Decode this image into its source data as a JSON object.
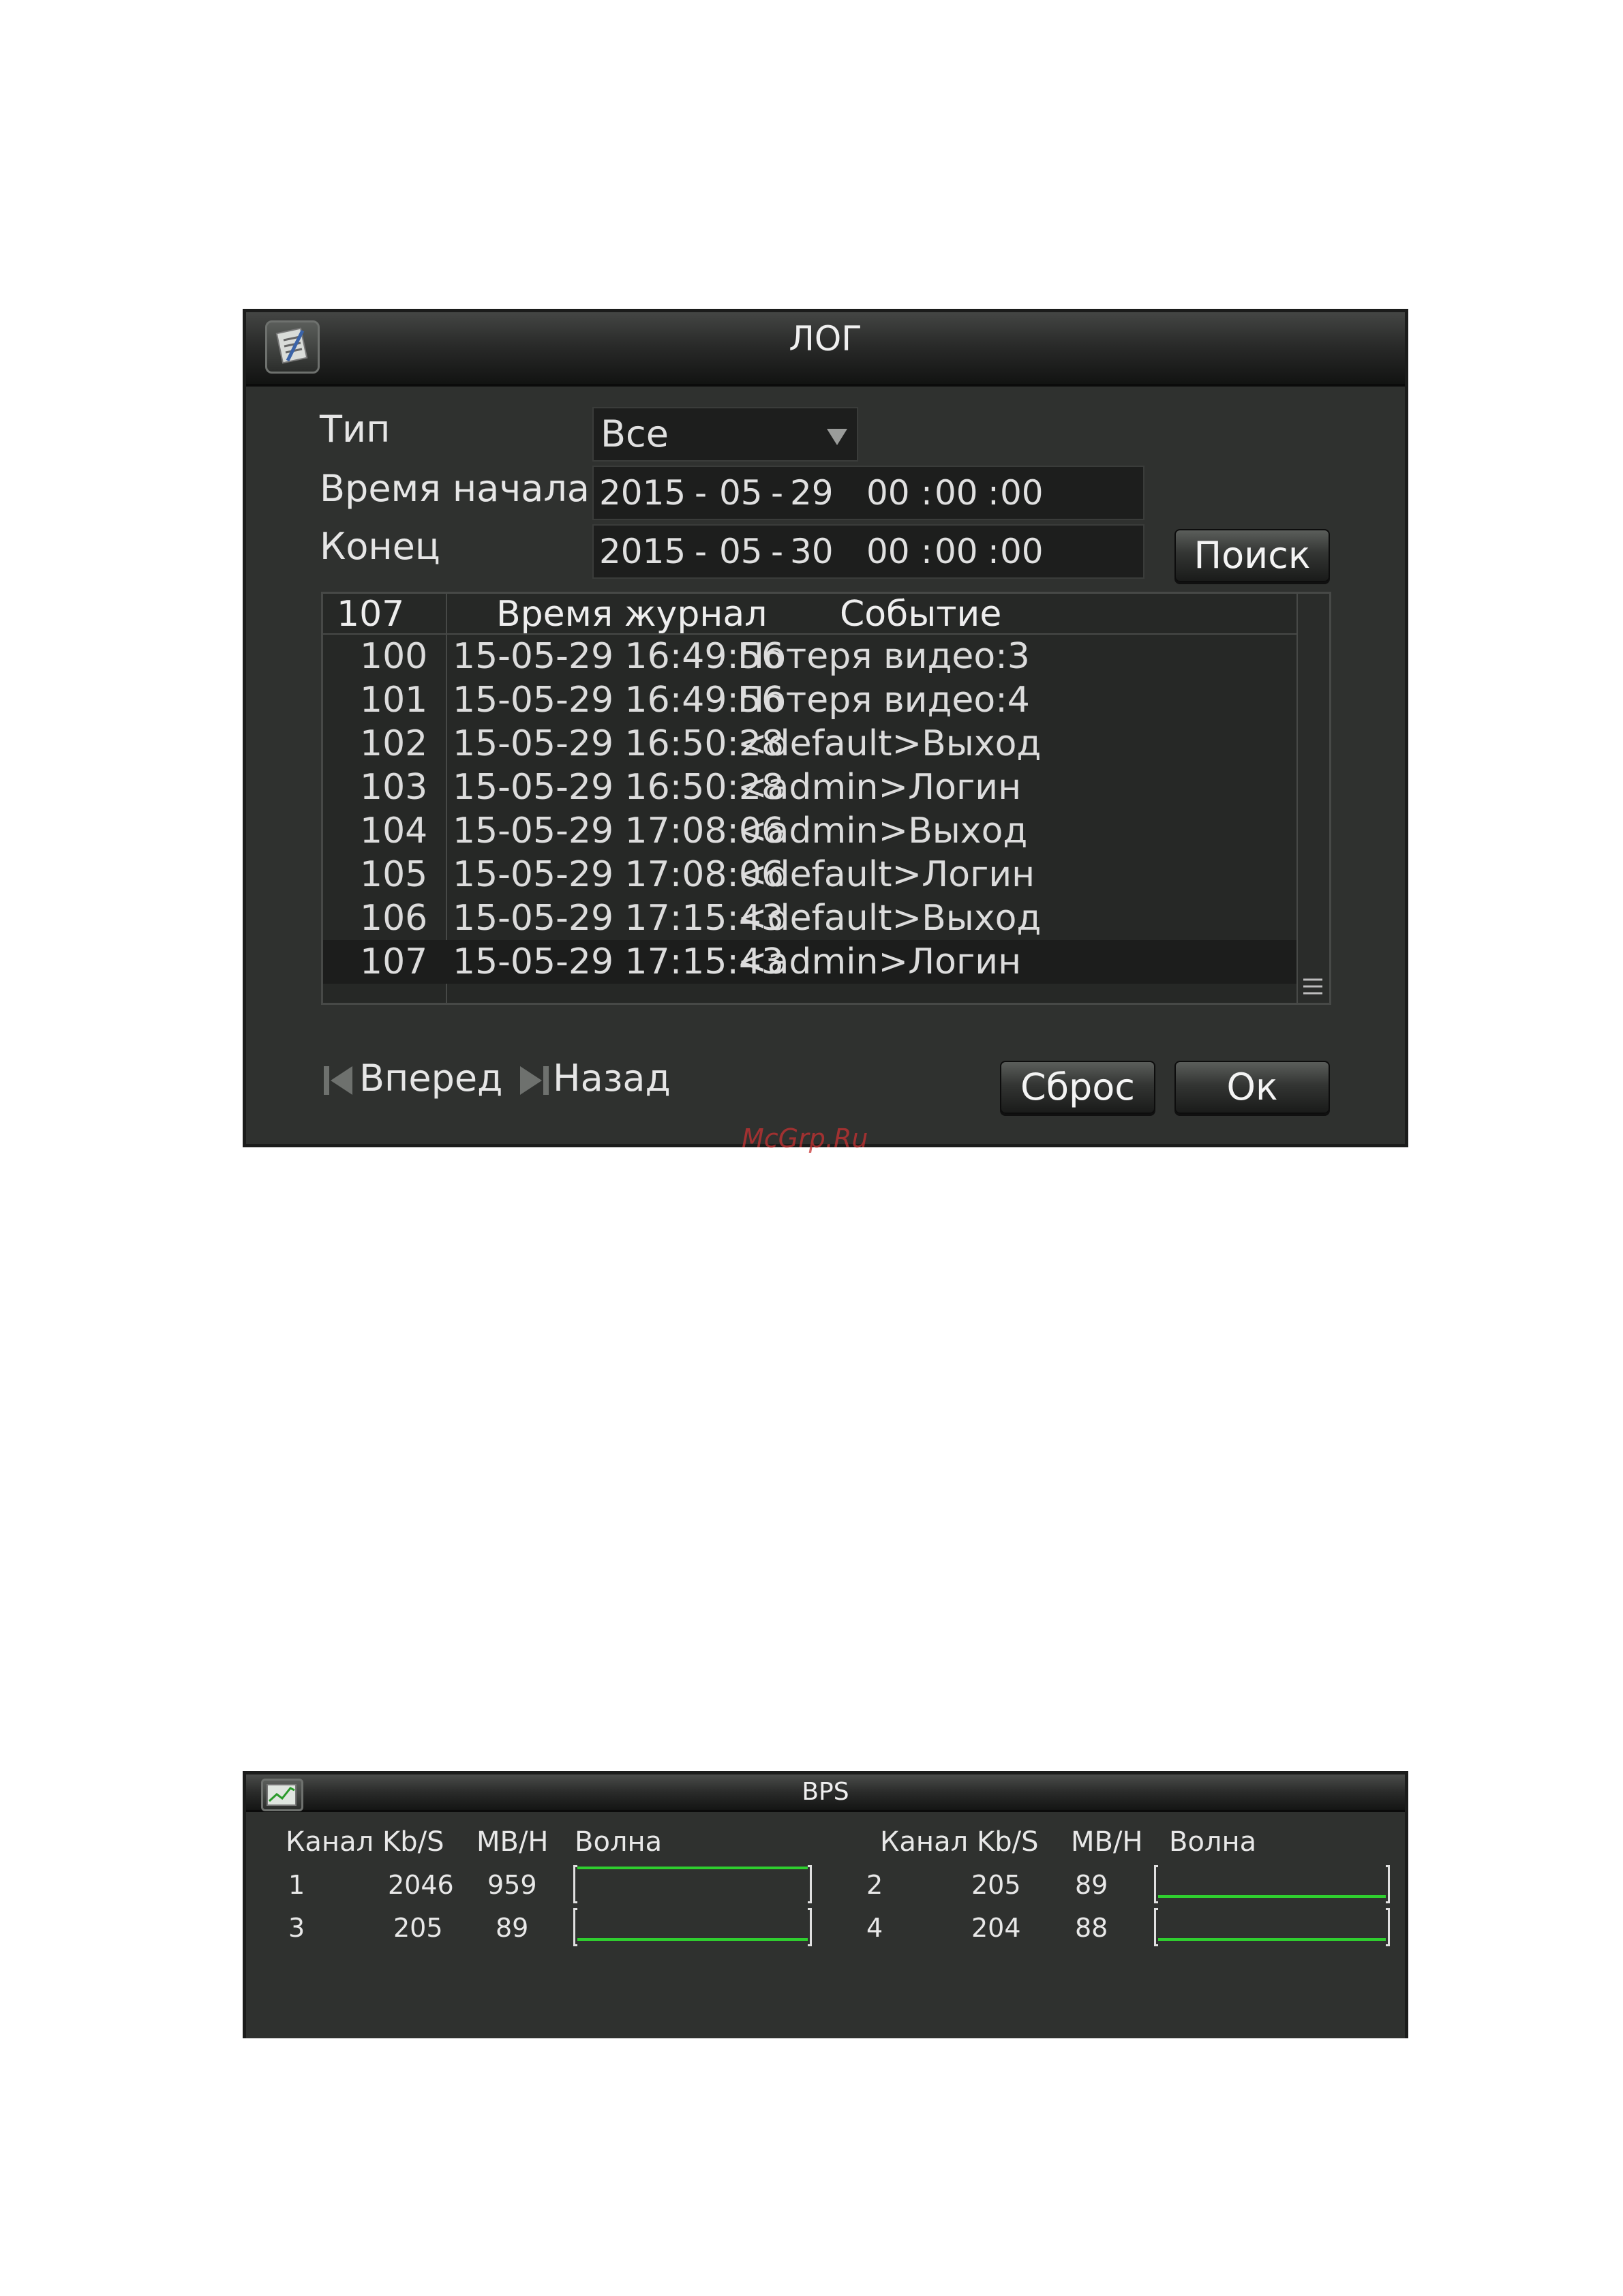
{
  "log": {
    "title": "ЛОГ",
    "type_label": "Тип",
    "type_value": "Все",
    "start_label": "Время начала",
    "start": {
      "year": "2015",
      "month": "05",
      "day": "29",
      "hh": "00",
      "mm": "00",
      "ss": "00"
    },
    "end_label": "Конец",
    "end": {
      "year": "2015",
      "month": "05",
      "day": "30",
      "hh": "00",
      "mm": "00",
      "ss": "00"
    },
    "search_button": "Поиск",
    "table": {
      "total": "107",
      "col_time": "Время журнал",
      "col_event": "Событие",
      "rows": [
        {
          "num": "100",
          "time": "15-05-29 16:49:56",
          "event": "Потеря видео:3"
        },
        {
          "num": "101",
          "time": "15-05-29 16:49:56",
          "event": "Потеря видео:4"
        },
        {
          "num": "102",
          "time": "15-05-29 16:50:28",
          "event": "<default>Выход"
        },
        {
          "num": "103",
          "time": "15-05-29 16:50:28",
          "event": "<admin>Логин"
        },
        {
          "num": "104",
          "time": "15-05-29 17:08:06",
          "event": "<admin>Выход"
        },
        {
          "num": "105",
          "time": "15-05-29 17:08:06",
          "event": "<default>Логин"
        },
        {
          "num": "106",
          "time": "15-05-29 17:15:43",
          "event": "<default>Выход"
        },
        {
          "num": "107",
          "time": "15-05-29 17:15:43",
          "event": "<admin>Логин"
        }
      ],
      "selected_row": 7
    },
    "prev_label": "Вперед",
    "next_label": "Назад",
    "reset_button": "Сброс",
    "ok_button": "Ок"
  },
  "watermark": "McGrp.Ru",
  "bps": {
    "title": "BPS",
    "headers": {
      "channel": "Канал",
      "kbs": "Kb/S",
      "mbh": "MB/H",
      "wave": "Волна"
    },
    "channels": [
      {
        "ch": "1",
        "kbs": "2046",
        "mbh": "959"
      },
      {
        "ch": "2",
        "kbs": "205",
        "mbh": "89"
      },
      {
        "ch": "3",
        "kbs": "205",
        "mbh": "89"
      },
      {
        "ch": "4",
        "kbs": "204",
        "mbh": "88"
      }
    ],
    "colors": {
      "wave": "#2fcf2f"
    }
  }
}
